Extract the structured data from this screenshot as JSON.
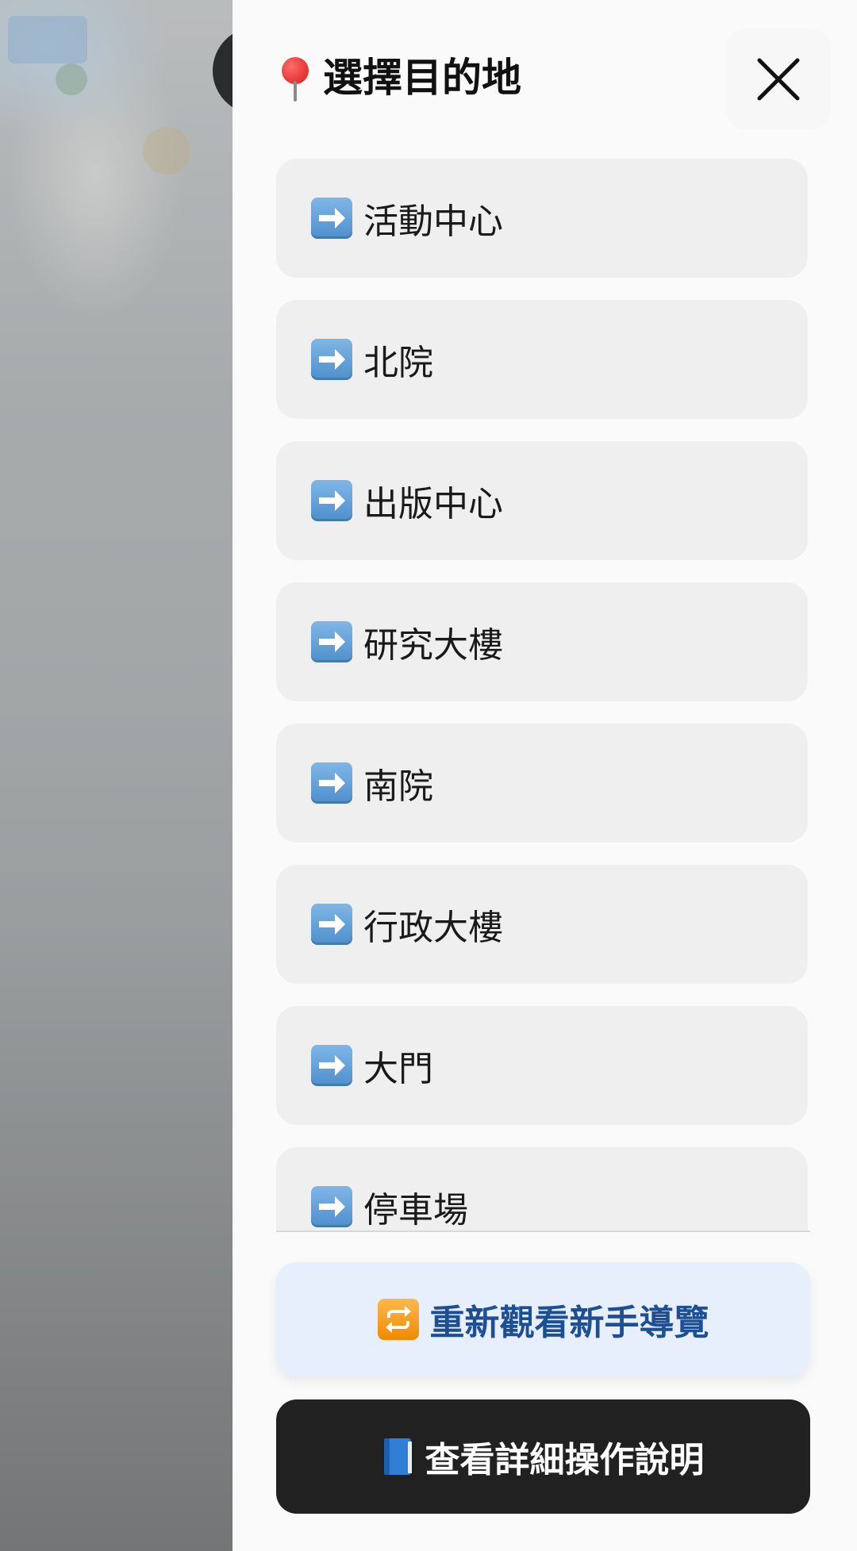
{
  "drawer": {
    "title": "選擇目的地",
    "title_icon": "pin-icon",
    "close_icon": "close-icon"
  },
  "destinations": [
    {
      "label": "活動中心",
      "icon": "arrow-right-icon"
    },
    {
      "label": "北院",
      "icon": "arrow-right-icon"
    },
    {
      "label": "出版中心",
      "icon": "arrow-right-icon"
    },
    {
      "label": "研究大樓",
      "icon": "arrow-right-icon"
    },
    {
      "label": "南院",
      "icon": "arrow-right-icon"
    },
    {
      "label": "行政大樓",
      "icon": "arrow-right-icon"
    },
    {
      "label": "大門",
      "icon": "arrow-right-icon"
    },
    {
      "label": "停車場",
      "icon": "arrow-right-icon"
    }
  ],
  "actions": {
    "tour_label": "重新觀看新手導覽",
    "tour_icon": "repeat-icon",
    "guide_label": "查看詳細操作說明",
    "guide_icon": "blue-book-icon"
  },
  "colors": {
    "drawer_bg": "#fafafa",
    "item_bg": "#efefef",
    "tour_bg": "#e7effc",
    "tour_text": "#1d4f94",
    "guide_bg": "#212121",
    "guide_text": "#ffffff"
  }
}
